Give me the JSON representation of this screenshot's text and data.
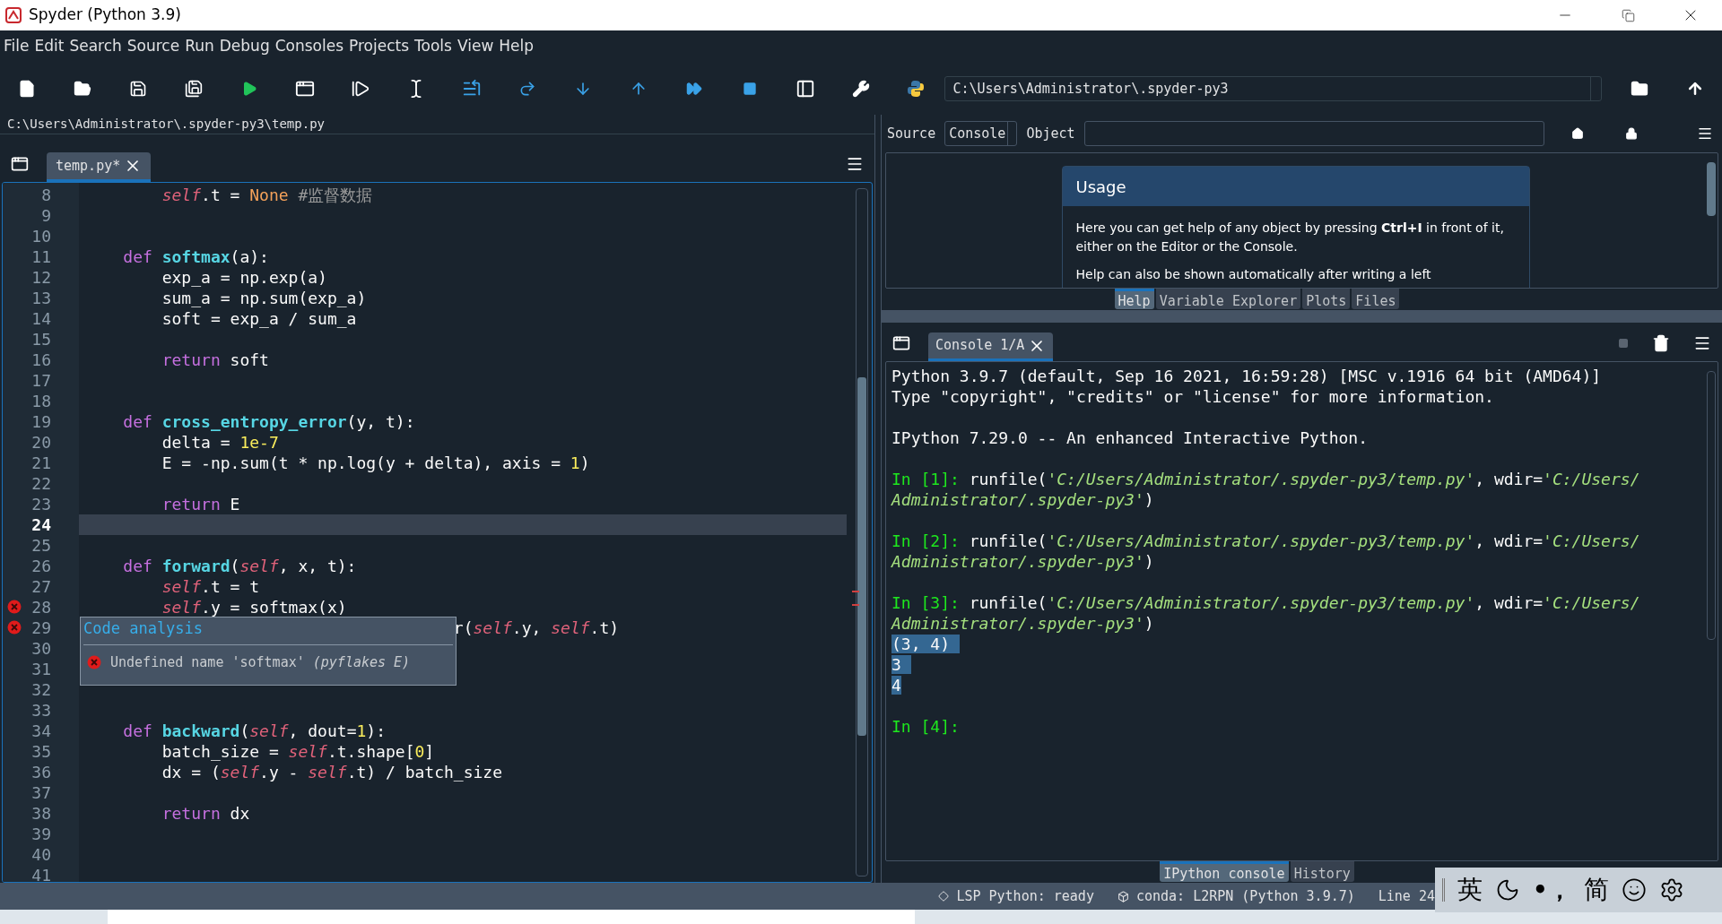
{
  "window": {
    "title": "Spyder (Python 3.9)"
  },
  "menu": [
    "File",
    "Edit",
    "Search",
    "Source",
    "Run",
    "Debug",
    "Consoles",
    "Projects",
    "Tools",
    "View",
    "Help"
  ],
  "toolbar": {
    "path": "C:\\Users\\Administrator\\.spyder-py3"
  },
  "editor": {
    "file_path": "C:\\Users\\Administrator\\.spyder-py3\\temp.py",
    "tabs": [
      {
        "label": "temp.py*",
        "selected": true
      }
    ],
    "lines": [
      {
        "number": "8",
        "current": false,
        "error": false,
        "tokens": [
          {
            "kind": "self",
            "text": "        self"
          },
          {
            "kind": "plain",
            "text": ".t = "
          },
          {
            "kind": "const",
            "text": "None"
          },
          {
            "kind": "comment",
            "text": " #监督数据"
          }
        ]
      },
      {
        "number": "9",
        "current": false,
        "error": false
      },
      {
        "number": "10",
        "current": false,
        "error": false
      },
      {
        "number": "11",
        "current": false,
        "error": false,
        "tokens": [
          {
            "kind": "keyword",
            "text": "    def"
          },
          {
            "kind": "function",
            "text": " softmax"
          },
          {
            "kind": "plain",
            "text": "(a):"
          }
        ]
      },
      {
        "number": "12",
        "current": false,
        "error": false,
        "tokens": [
          {
            "kind": "plain",
            "text": "        exp_a = np.exp(a)"
          }
        ]
      },
      {
        "number": "13",
        "current": false,
        "error": false,
        "tokens": [
          {
            "kind": "plain",
            "text": "        sum_a = np.sum(exp_a)"
          }
        ]
      },
      {
        "number": "14",
        "current": false,
        "error": false,
        "tokens": [
          {
            "kind": "plain",
            "text": "        soft = exp_a / sum_a"
          }
        ]
      },
      {
        "number": "15",
        "current": false,
        "error": false
      },
      {
        "number": "16",
        "current": false,
        "error": false,
        "tokens": [
          {
            "kind": "keyword",
            "text": "        return"
          },
          {
            "kind": "plain",
            "text": " soft"
          }
        ]
      },
      {
        "number": "17",
        "current": false,
        "error": false
      },
      {
        "number": "18",
        "current": false,
        "error": false
      },
      {
        "number": "19",
        "current": false,
        "error": false,
        "tokens": [
          {
            "kind": "keyword",
            "text": "    def"
          },
          {
            "kind": "function",
            "text": " cross_entropy_error"
          },
          {
            "kind": "plain",
            "text": "(y, t):"
          }
        ]
      },
      {
        "number": "20",
        "current": false,
        "error": false,
        "tokens": [
          {
            "kind": "plain",
            "text": "        delta = "
          },
          {
            "kind": "number",
            "text": "1e-7"
          }
        ]
      },
      {
        "number": "21",
        "current": false,
        "error": false,
        "tokens": [
          {
            "kind": "plain",
            "text": "        E = -np.sum(t * np.log(y + delta), axis = "
          },
          {
            "kind": "number",
            "text": "1"
          },
          {
            "kind": "plain",
            "text": ")"
          }
        ]
      },
      {
        "number": "22",
        "current": false,
        "error": false
      },
      {
        "number": "23",
        "current": false,
        "error": false,
        "tokens": [
          {
            "kind": "keyword",
            "text": "        return"
          },
          {
            "kind": "plain",
            "text": " E"
          }
        ]
      },
      {
        "number": "24",
        "current": true,
        "error": false
      },
      {
        "number": "25",
        "current": false,
        "error": false
      },
      {
        "number": "26",
        "current": false,
        "error": false,
        "tokens": [
          {
            "kind": "keyword",
            "text": "    def"
          },
          {
            "kind": "function",
            "text": " forward"
          },
          {
            "kind": "plain",
            "text": "("
          },
          {
            "kind": "self",
            "text": "self"
          },
          {
            "kind": "plain",
            "text": ", x, t):"
          }
        ]
      },
      {
        "number": "27",
        "current": false,
        "error": false,
        "tokens": [
          {
            "kind": "self",
            "text": "        self"
          },
          {
            "kind": "plain",
            "text": ".t = t"
          }
        ]
      },
      {
        "number": "28",
        "current": false,
        "error": true,
        "tokens": [
          {
            "kind": "self",
            "text": "        self"
          },
          {
            "kind": "plain",
            "text": ".y = softmax(x)"
          }
        ]
      },
      {
        "number": "29",
        "current": false,
        "error": true,
        "kind": "behind_tooltip",
        "tokens": [
          {
            "kind": "plain",
            "text": "r("
          },
          {
            "kind": "self",
            "text": "self"
          },
          {
            "kind": "plain",
            "text": ".y, "
          },
          {
            "kind": "self",
            "text": "self"
          },
          {
            "kind": "plain",
            "text": ".t)"
          }
        ]
      },
      {
        "number": "30",
        "current": false,
        "error": false
      },
      {
        "number": "31",
        "current": false,
        "error": false
      },
      {
        "number": "32",
        "current": false,
        "error": false
      },
      {
        "number": "33",
        "current": false,
        "error": false
      },
      {
        "number": "34",
        "current": false,
        "error": false,
        "tokens": [
          {
            "kind": "keyword",
            "text": "    def"
          },
          {
            "kind": "function",
            "text": " backward"
          },
          {
            "kind": "plain",
            "text": "("
          },
          {
            "kind": "self",
            "text": "self"
          },
          {
            "kind": "plain",
            "text": ", dout="
          },
          {
            "kind": "number",
            "text": "1"
          },
          {
            "kind": "plain",
            "text": "):"
          }
        ]
      },
      {
        "number": "35",
        "current": false,
        "error": false,
        "tokens": [
          {
            "kind": "plain",
            "text": "        batch_size = "
          },
          {
            "kind": "self",
            "text": "self"
          },
          {
            "kind": "plain",
            "text": ".t.shape["
          },
          {
            "kind": "number",
            "text": "0"
          },
          {
            "kind": "plain",
            "text": "]"
          }
        ]
      },
      {
        "number": "36",
        "current": false,
        "error": false,
        "tokens": [
          {
            "kind": "plain",
            "text": "        dx = ("
          },
          {
            "kind": "self",
            "text": "self"
          },
          {
            "kind": "plain",
            "text": ".y - "
          },
          {
            "kind": "self",
            "text": "self"
          },
          {
            "kind": "plain",
            "text": ".t) / batch_size"
          }
        ]
      },
      {
        "number": "37",
        "current": false,
        "error": false
      },
      {
        "number": "38",
        "current": false,
        "error": false,
        "tokens": [
          {
            "kind": "keyword",
            "text": "        return"
          },
          {
            "kind": "plain",
            "text": " dx"
          }
        ]
      },
      {
        "number": "39",
        "current": false,
        "error": false
      },
      {
        "number": "40",
        "current": false,
        "error": false
      },
      {
        "number": "41",
        "current": false,
        "error": false
      }
    ],
    "tooltip": {
      "title": "Code analysis",
      "message": "Undefined name 'softmax' *(pyflakes E)*"
    }
  },
  "help": {
    "source_label": "Source",
    "source_value": "Console",
    "object_label": "Object",
    "usage_title": "Usage",
    "paragraphs": [
      "Here you can get help of any object by pressing **Ctrl+I** in front of it, either on the Editor or the Console.",
      "Help can also be shown automatically after writing a left"
    ],
    "tabs": [
      {
        "label": "Help",
        "selected": true
      },
      {
        "label": "Variable Explorer",
        "selected": false
      },
      {
        "label": "Plots",
        "selected": false
      },
      {
        "label": "Files",
        "selected": false
      }
    ]
  },
  "console": {
    "tabs": [
      {
        "label": "Console 1/A",
        "selected": true
      }
    ],
    "blocks": [
      {
        "lines": [
          {
            "tokens": [
              {
                "kind": "plain",
                "text": "Python 3.9.7 (default, Sep 16 2021, 16:59:28) [MSC v.1916 64 bit (AMD64)]"
              }
            ]
          },
          {
            "tokens": [
              {
                "kind": "plain",
                "text": "Type \"copyright\", \"credits\" or \"license\" for more information."
              }
            ]
          }
        ]
      },
      {
        "lines": [
          {
            "tokens": [
              {
                "kind": "plain",
                "text": "IPython 7.29.0 -- An enhanced Interactive Python."
              }
            ]
          }
        ]
      },
      {
        "lines": [
          {
            "tokens": [
              {
                "kind": "prompt",
                "text": "In [1]:"
              },
              {
                "kind": "plain",
                "text": " runfile("
              },
              {
                "kind": "string",
                "text": "'C:/Users/Administrator/.spyder-py3/temp.py'"
              },
              {
                "kind": "plain",
                "text": ", wdir="
              },
              {
                "kind": "string",
                "text": "'C:/Users/"
              }
            ]
          },
          {
            "tokens": [
              {
                "kind": "string",
                "text": "Administrator/.spyder-py3'"
              },
              {
                "kind": "plain",
                "text": ")"
              }
            ]
          }
        ]
      },
      {
        "lines": [
          {
            "tokens": [
              {
                "kind": "prompt",
                "text": "In [2]:"
              },
              {
                "kind": "plain",
                "text": " runfile("
              },
              {
                "kind": "string",
                "text": "'C:/Users/Administrator/.spyder-py3/temp.py'"
              },
              {
                "kind": "plain",
                "text": ", wdir="
              },
              {
                "kind": "string",
                "text": "'C:/Users/"
              }
            ]
          },
          {
            "tokens": [
              {
                "kind": "string",
                "text": "Administrator/.spyder-py3'"
              },
              {
                "kind": "plain",
                "text": ")"
              }
            ]
          }
        ]
      },
      {
        "lines": [
          {
            "tokens": [
              {
                "kind": "prompt",
                "text": "In [3]:"
              },
              {
                "kind": "plain",
                "text": " runfile("
              },
              {
                "kind": "string",
                "text": "'C:/Users/Administrator/.spyder-py3/temp.py'"
              },
              {
                "kind": "plain",
                "text": ", wdir="
              },
              {
                "kind": "string",
                "text": "'C:/Users/"
              }
            ]
          },
          {
            "tokens": [
              {
                "kind": "string",
                "text": "Administrator/.spyder-py3'"
              },
              {
                "kind": "plain",
                "text": ")"
              }
            ]
          },
          {
            "tokens": [
              {
                "kind": "selected",
                "text": "(3, 4) "
              }
            ]
          },
          {
            "tokens": [
              {
                "kind": "selected",
                "text": "3 "
              }
            ]
          },
          {
            "tokens": [
              {
                "kind": "selected",
                "text": "4"
              }
            ]
          }
        ]
      },
      {
        "lines": [
          {
            "tokens": [
              {
                "kind": "prompt",
                "text": "In [4]:"
              }
            ]
          }
        ]
      }
    ],
    "bottom_tabs": [
      {
        "label": "IPython console",
        "selected": true
      },
      {
        "label": "History",
        "selected": false
      }
    ]
  },
  "status_bar": {
    "lsp": "LSP Python: ready",
    "conda": "conda: L2RPN (Python 3.9.7)",
    "position": "Line 24"
  },
  "ime": {
    "language": "英",
    "punctuation": "•，",
    "script": "简"
  }
}
